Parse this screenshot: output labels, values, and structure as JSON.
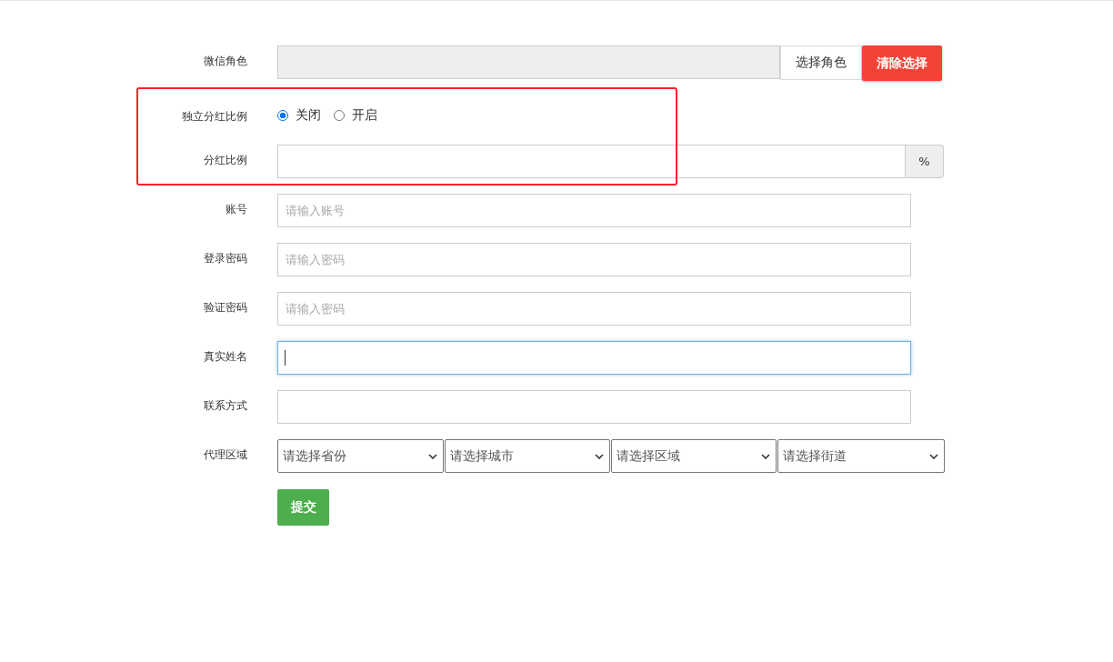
{
  "sections": [
    {
      "highlighted": false,
      "rows": [
        {
          "kind": "picker",
          "label": "微信角色",
          "value": "",
          "buttons": [
            {
              "label": "选择角色",
              "kind": "default"
            },
            {
              "label": "清除选择",
              "kind": "danger"
            }
          ]
        }
      ]
    },
    {
      "highlighted": true,
      "rows": [
        {
          "kind": "radio",
          "label": "独立分红比例",
          "options": [
            {
              "label": "关闭",
              "selected": true
            },
            {
              "label": "开启",
              "selected": false
            }
          ]
        },
        {
          "kind": "addon",
          "label": "分红比例",
          "value": "",
          "addon": "%"
        }
      ]
    },
    {
      "highlighted": false,
      "rows": [
        {
          "kind": "text",
          "label": "账号",
          "placeholder": "请输入账号",
          "focused": false
        },
        {
          "kind": "text",
          "label": "登录密码",
          "placeholder": "请输入密码",
          "focused": false
        },
        {
          "kind": "text",
          "label": "验证密码",
          "placeholder": "请输入密码",
          "focused": false
        },
        {
          "kind": "text",
          "label": "真实姓名",
          "focused": true
        },
        {
          "kind": "text",
          "label": "联系方式",
          "focused": false
        },
        {
          "kind": "selects",
          "label": "代理区域",
          "selects": [
            "请选择省份",
            "请选择城市",
            "请选择区域",
            "请选择街道"
          ]
        }
      ]
    }
  ],
  "submit": "提交"
}
